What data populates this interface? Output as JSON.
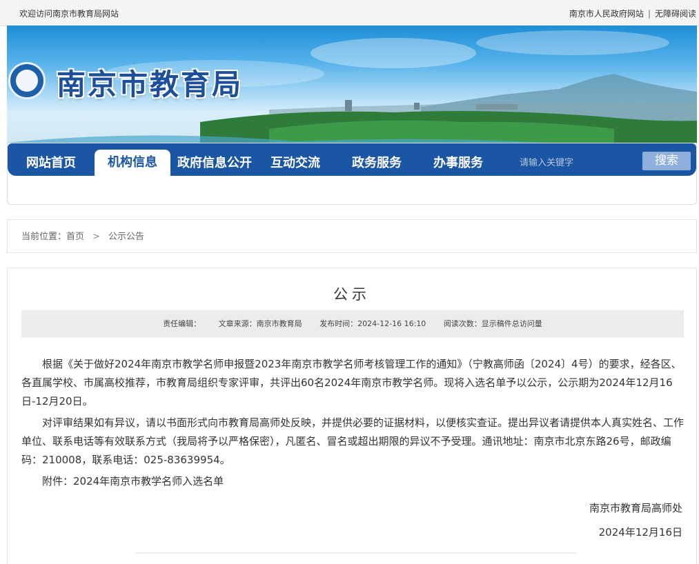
{
  "topbar": {
    "welcome": "欢迎访问南京市教育局网站",
    "links": [
      "南京市人民政府网站",
      "无障碍阅读"
    ],
    "separator": "|"
  },
  "header": {
    "site_title": "南京市教育局"
  },
  "nav": {
    "items": [
      {
        "label": "网站首页",
        "active": false
      },
      {
        "label": "机构信息",
        "active": true
      },
      {
        "label": "政府信息公开",
        "active": false
      },
      {
        "label": "互动交流",
        "active": false
      },
      {
        "label": "政务服务",
        "active": false
      },
      {
        "label": "办事服务",
        "active": false
      }
    ],
    "search_placeholder": "请输入关键字",
    "search_button": "搜索"
  },
  "breadcrumb": {
    "prefix": "当前位置：",
    "home": "首页",
    "chevron": ">",
    "current": "公示公告"
  },
  "article": {
    "title": "公示",
    "meta": {
      "editor": "责任编辑：",
      "source": "文章来源：南京市教育局",
      "published": "发布时间：2024-12-16 16:10",
      "views": "阅读次数：显示稿件总访问量"
    },
    "paragraphs": [
      "根据《关于做好2024年南京市教学名师申报暨2023年南京市教学名师考核管理工作的通知》（宁教高师函〔2024〕4号）的要求，经各区、各直属学校、市属高校推荐，市教育局组织专家评审，共评出60名2024年南京市教学名师。现将入选名单予以公示，公示期为2024年12月16日-12月20日。",
      "对评审结果如有异议，请以书面形式向市教育局高师处反映，并提供必要的证据材料，以便核实查证。提出异议者请提供本人真实姓名、工作单位、联系电话等有效联系方式（我局将予以严格保密），凡匿名、冒名或超出期限的异议不予受理。通讯地址：南京市北京东路26号，邮政编码：210008，联系电话：025-83639954。",
      "附件：2024年南京市教学名师入选名单"
    ],
    "signature_org": "南京市教育局高师处",
    "signature_date": "2024年12月16日"
  }
}
